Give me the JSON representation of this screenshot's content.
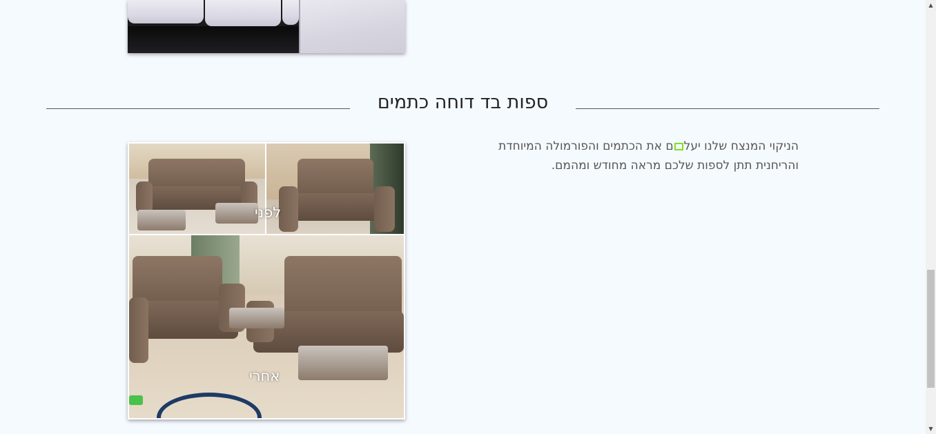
{
  "section": {
    "title": "ספות בד דוחה כתמים",
    "description_part1": "הניקוי המנצח שלנו יעל",
    "description_part2": "ם את הכתמים והפורמולה המיוחדת והריחנית תתן לספות שלכם מראה מחודש ומהמם."
  },
  "collage": {
    "before_label": "לפני",
    "after_label": "אחרי"
  },
  "colors": {
    "background": "#f5faff",
    "highlight": "#7ce01e"
  },
  "icons": {
    "scroll_up": "triangle-up",
    "scroll_down": "triangle-down"
  }
}
